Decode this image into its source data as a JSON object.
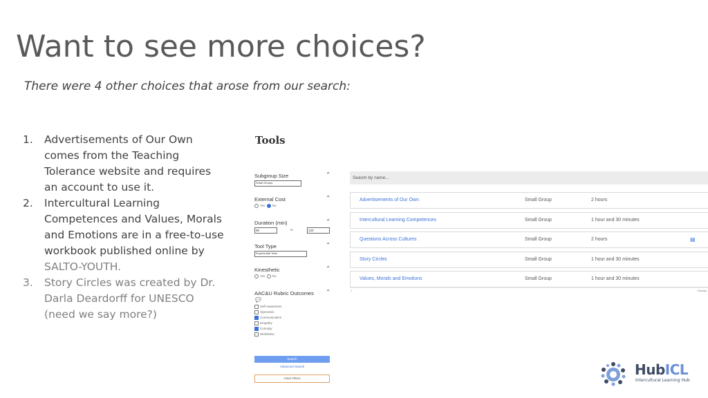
{
  "slide": {
    "title": "Want to see more choices?",
    "subtitle": "There were 4 other choices that arose from our search:",
    "items": [
      {
        "num": "1.",
        "lines": [
          "Advertisements of Our Own",
          "comes from the Teaching",
          "Tolerance website and requires",
          "an account to use it."
        ]
      },
      {
        "num": "2.",
        "lines": [
          "Intercultural Learning",
          "Competences and Values, Morals",
          "and Emotions are in a free-to-use",
          "workbook published online by"
        ],
        "tail": "SALTO-YOUTH."
      },
      {
        "num": "3.",
        "lines": [
          "Story Circles was created by Dr.",
          "Darla Deardorff for UNESCO",
          "(need we say more?)"
        ]
      }
    ]
  },
  "screenshot": {
    "heading": "Tools",
    "filters": {
      "subgroup": {
        "label": "Subgroup Size",
        "value": "Small Groups"
      },
      "external_cost": {
        "label": "External Cost",
        "yes": "Yes",
        "no": "No"
      },
      "duration": {
        "label": "Duration (min)",
        "min": "90",
        "to": "to",
        "max": "120"
      },
      "tool_type": {
        "label": "Tool Type",
        "value": "Experiential Tools"
      },
      "kinesthetic": {
        "label": "Kinesthetic",
        "yes": "Yes",
        "no": "No"
      },
      "rubric": {
        "label": "AAC&U Rubric Outcomes",
        "options": [
          "Self-Awareness",
          "Openness",
          "Communication",
          "Empathy",
          "Curiosity",
          "Worldview"
        ]
      }
    },
    "search_button": "Search",
    "advanced_search": "Advanced Search",
    "clear_filters": "Clear Filters",
    "search_placeholder": "Search by name...",
    "results": [
      {
        "name": "Advertisements of Our Own",
        "group": "Small Group",
        "duration": "2 hours"
      },
      {
        "name": "Intercultural Learning Competences",
        "group": "Small Group",
        "duration": "1 hour and 30 minutes"
      },
      {
        "name": "Questions Across Cultures",
        "group": "Small Group",
        "duration": "2 hours"
      },
      {
        "name": "Story Circles",
        "group": "Small Group",
        "duration": "1 hour and 30 minutes"
      },
      {
        "name": "Values, Morals and Emotions",
        "group": "Small Group",
        "duration": "1 hour and 30 minutes"
      }
    ],
    "pager": "1",
    "display_label": "Display"
  },
  "logo": {
    "hub": "Hub",
    "icl": "ICL",
    "sub": "Intercultural Learning Hub"
  }
}
